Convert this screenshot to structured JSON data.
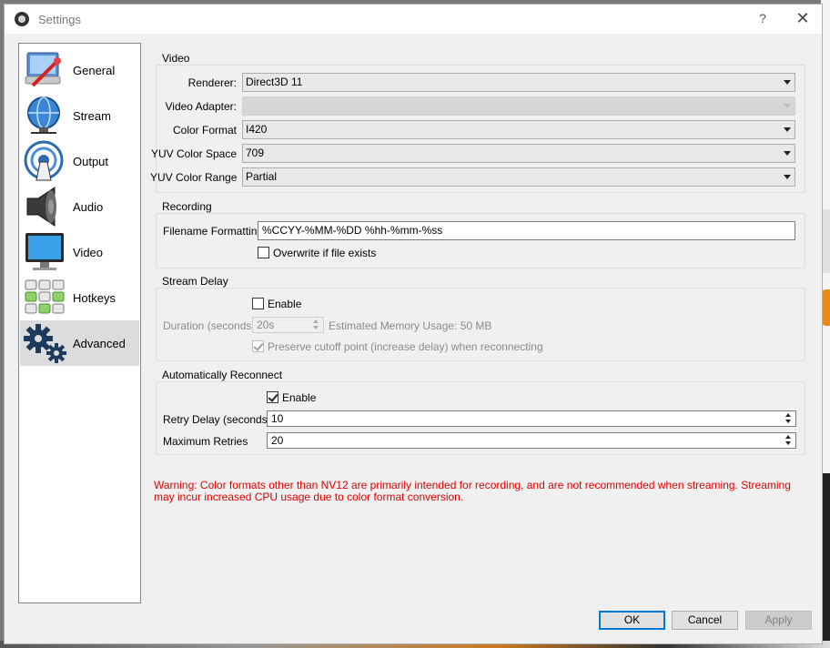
{
  "window": {
    "title": "Settings",
    "help_label": "?",
    "close_label": "✕"
  },
  "sidebar": {
    "items": [
      {
        "label": "General",
        "icon": "general-icon"
      },
      {
        "label": "Stream",
        "icon": "stream-globe-icon"
      },
      {
        "label": "Output",
        "icon": "output-broadcast-icon"
      },
      {
        "label": "Audio",
        "icon": "audio-speaker-icon"
      },
      {
        "label": "Video",
        "icon": "video-monitor-icon"
      },
      {
        "label": "Hotkeys",
        "icon": "hotkeys-keyboard-icon"
      },
      {
        "label": "Advanced",
        "icon": "advanced-gears-icon",
        "selected": true
      }
    ]
  },
  "video": {
    "title": "Video",
    "renderer_label": "Renderer:",
    "renderer_value": "Direct3D 11",
    "adapter_label": "Video Adapter:",
    "adapter_value": "",
    "color_format_label": "Color Format",
    "color_format_value": "I420",
    "yuv_space_label": "YUV Color Space",
    "yuv_space_value": "709",
    "yuv_range_label": "YUV Color Range",
    "yuv_range_value": "Partial"
  },
  "recording": {
    "title": "Recording",
    "filename_label": "Filename Formatting",
    "filename_value": "%CCYY-%MM-%DD %hh-%mm-%ss",
    "overwrite_label": "Overwrite if file exists",
    "overwrite_checked": false
  },
  "stream_delay": {
    "title": "Stream Delay",
    "enable_label": "Enable",
    "enable_checked": false,
    "duration_label": "Duration (seconds)",
    "duration_value": "20s",
    "memory_label": "Estimated Memory Usage: 50 MB",
    "preserve_label": "Preserve cutoff point (increase delay) when reconnecting",
    "preserve_checked": true
  },
  "reconnect": {
    "title": "Automatically Reconnect",
    "enable_label": "Enable",
    "enable_checked": true,
    "retry_delay_label": "Retry Delay (seconds)",
    "retry_delay_value": "10",
    "max_retries_label": "Maximum Retries",
    "max_retries_value": "20"
  },
  "warning": "Warning:  Color formats other than NV12 are primarily intended for recording, and are not recommended when streaming.  Streaming may incur increased CPU usage due to color format conversion.",
  "buttons": {
    "ok": "OK",
    "cancel": "Cancel",
    "apply": "Apply"
  },
  "colors": {
    "warning": "#e00000",
    "accent": "#0078d7",
    "selected_bg": "#dcdcdc"
  }
}
